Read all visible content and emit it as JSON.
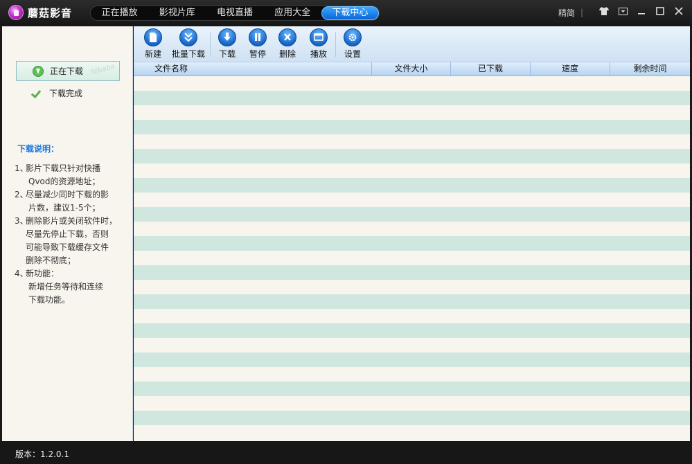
{
  "app": {
    "title": "蘑菇影音"
  },
  "nav": {
    "tabs": [
      {
        "label": "正在播放"
      },
      {
        "label": "影视片库"
      },
      {
        "label": "电视直播"
      },
      {
        "label": "应用大全"
      },
      {
        "label": "下载中心"
      }
    ]
  },
  "window": {
    "lang_label": "精简",
    "divider": "|"
  },
  "sidebar": {
    "items": [
      {
        "label": "正在下载"
      },
      {
        "label": "下载完成"
      }
    ],
    "watermark": "Nibaba",
    "notes_title": "下载说明：",
    "notes": [
      {
        "num": "1、",
        "lines": [
          "影片下载只针对快播",
          "Qvod的资源地址；"
        ]
      },
      {
        "num": "2、",
        "lines": [
          "尽量减少同时下载的影",
          "片数，建议1-5个；"
        ]
      },
      {
        "num": "3、",
        "lines": [
          "删除影片或关闭软件时，",
          "尽量先停止下载，否则",
          "可能导致下载缓存文件",
          "删除不彻底；"
        ]
      },
      {
        "num": "4、",
        "lines": [
          "新功能：",
          "新增任务等待和连续",
          "下载功能。"
        ]
      }
    ]
  },
  "toolbar": {
    "buttons": [
      {
        "label": "新建",
        "icon": "new-file-icon"
      },
      {
        "label": "批量下载",
        "icon": "batch-download-icon"
      },
      {
        "label": "下载",
        "icon": "download-icon"
      },
      {
        "label": "暂停",
        "icon": "pause-icon"
      },
      {
        "label": "删除",
        "icon": "delete-icon"
      },
      {
        "label": "播放",
        "icon": "play-icon"
      },
      {
        "label": "设置",
        "icon": "gear-icon"
      }
    ]
  },
  "table": {
    "columns": [
      {
        "label": "文件名称"
      },
      {
        "label": "文件大小"
      },
      {
        "label": "已下载"
      },
      {
        "label": "速度"
      },
      {
        "label": "剩余时间"
      }
    ]
  },
  "status": {
    "version": "版本：1.2.0.1"
  }
}
